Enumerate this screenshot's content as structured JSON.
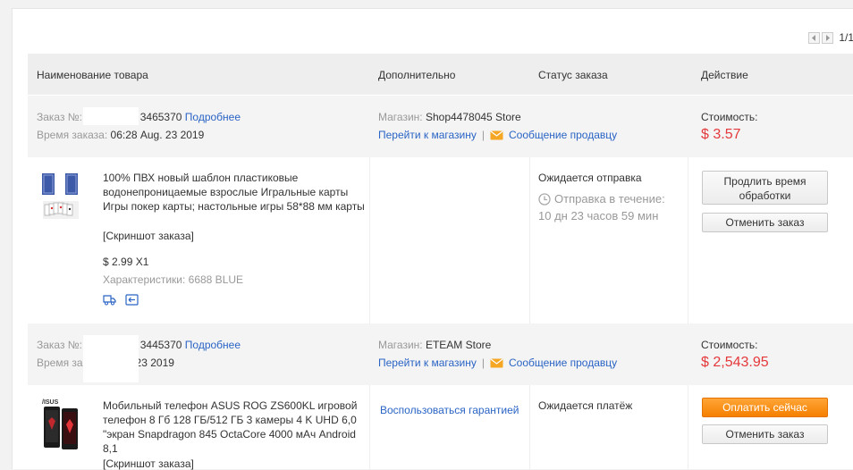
{
  "pager": {
    "prev_icon": "chevron-left-icon",
    "next_icon": "chevron-right-icon",
    "page": "1/1"
  },
  "table_header": {
    "product": "Наименование товара",
    "extra": "Дополнительно",
    "status": "Статус заказа",
    "action": "Действие"
  },
  "orders": [
    {
      "order_label": "Заказ №:",
      "order_suffix": "3465370",
      "details_link": "Подробнее",
      "time_label": "Время заказа:",
      "time_value": "06:28 Aug. 23 2019",
      "store_label": "Магазин:",
      "store_name": "Shop4478045 Store",
      "go_store": "Перейти к магазину",
      "separator": "|",
      "message_seller": "Сообщение продавцу",
      "cost_label": "Стоимость:",
      "cost_value": "$ 3.57",
      "item": {
        "title": "100% ПВХ новый шаблон пластиковые водонепроницаемые взрослые Игральные карты Игры покер карты; настольные игры 58*88 мм карты",
        "snapshot": "[Скриншот заказа]",
        "price_qty": "$ 2.99 X1",
        "chars_label": "Характеристики:",
        "chars_value": "6688 BLUE",
        "extra_link": "",
        "status": "Ожидается отправка",
        "countdown_label": "Отправка в течение:",
        "countdown_value": "10 дн 23 часов 59 мин",
        "btn1": "Продлить время обработки",
        "btn2": "Отменить заказ"
      }
    },
    {
      "order_label": "Заказ №:",
      "order_suffix": "3445370",
      "details_link": "Подробнее",
      "time_label": "Время заказа:",
      "time_value": "Aug. 23 2019",
      "store_label": "Магазин:",
      "store_name": "ETEAM Store",
      "go_store": "Перейти к магазину",
      "separator": "|",
      "message_seller": "Сообщение продавцу",
      "cost_label": "Стоимость:",
      "cost_value": "$ 2,543.95",
      "item": {
        "title": "Мобильный телефон ASUS ROG ZS600KL игровой телефон 8 Гб 128 ГБ/512 ГБ 3 камеры 4 K UHD 6,0 \"экран Snapdragon 845 OctaCore 4000 мАч Android 8,1",
        "snapshot": "[Скриншот заказа]",
        "brand_text": "/ISUS",
        "extra_link": "Воспользоваться гарантией",
        "status": "Ожидается платёж",
        "btn1": "Оплатить сейчас",
        "btn2": "Отменить заказ"
      }
    }
  ],
  "colors": {
    "link": "#2a64c5",
    "price": "#e4393c",
    "primary_button": "#f57f00"
  }
}
